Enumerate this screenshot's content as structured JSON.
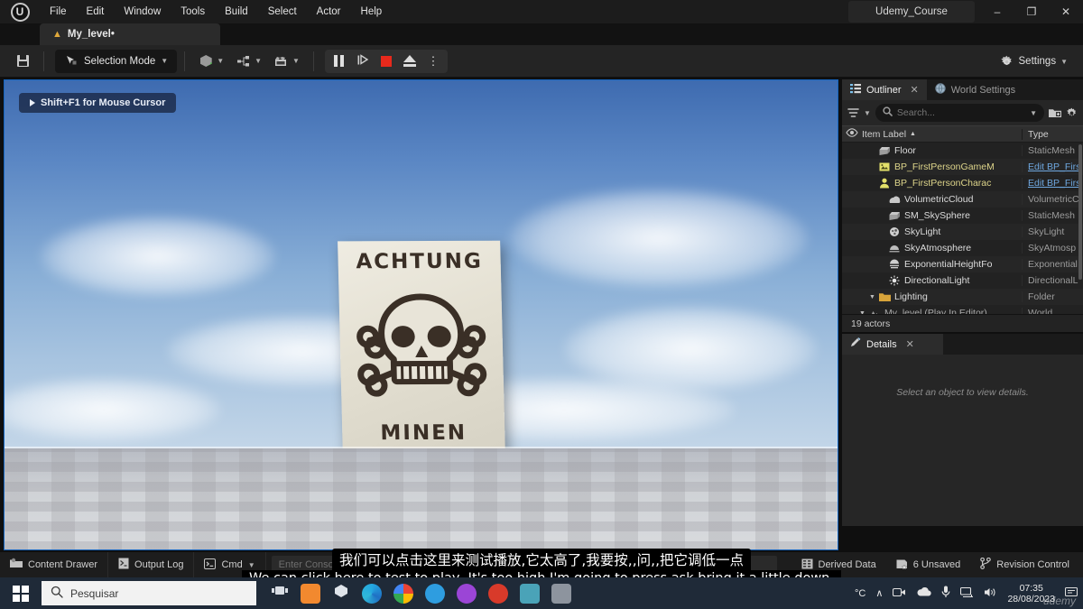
{
  "titlebar": {
    "logo_icon": "unreal-engine-logo",
    "menus": [
      "File",
      "Edit",
      "Window",
      "Tools",
      "Build",
      "Select",
      "Actor",
      "Help"
    ],
    "project_name": "Udemy_Course",
    "window_controls": {
      "minimize": "–",
      "maximize": "❐",
      "close": "✕"
    }
  },
  "level_tab": {
    "label": "My_level•",
    "icon": "level-icon"
  },
  "toolbar": {
    "save_icon": "save-icon",
    "mode_label": "Selection Mode",
    "add_icon": "add-actor-icon",
    "blueprints_icon": "blueprints-icon",
    "cinematics_icon": "cinematics-icon",
    "pause_icon": "pause-icon",
    "step_icon": "frame-step-icon",
    "stop_icon": "stop-icon",
    "eject_icon": "eject-icon",
    "more_icon": "more-options-icon",
    "settings_label": "Settings",
    "settings_icon": "gear-icon"
  },
  "viewport": {
    "hint": "Shift+F1 for Mouse Cursor",
    "sign_top_text": "ACHTUNG",
    "sign_bottom_text": "MINEN",
    "sign_symbol": "skull-and-crossbones"
  },
  "outliner": {
    "tab_label": "Outliner",
    "tab_icon": "outliner-icon",
    "world_settings_tab": "World Settings",
    "world_settings_icon": "globe-icon",
    "filter_icon": "filter-icon",
    "search_placeholder": "Search...",
    "search_value": "",
    "new_folder_icon": "new-folder-icon",
    "settings_icon": "gear-icon",
    "columns": {
      "visibility": "eye-icon",
      "label": "Item Label",
      "sort": "▲",
      "type": "Type"
    },
    "rows": [
      {
        "name": "My_level (Play In Editor)",
        "type": "World",
        "indent": 1,
        "icon": "level-icon",
        "expander": "▼",
        "kind": "world"
      },
      {
        "name": "Lighting",
        "type": "Folder",
        "indent": 2,
        "icon": "folder-icon",
        "expander": "▼",
        "kind": "folder"
      },
      {
        "name": "DirectionalLight",
        "type": "DirectionalL",
        "indent": 3,
        "icon": "directional-light-icon",
        "expander": "",
        "kind": "actor"
      },
      {
        "name": "ExponentialHeightFo",
        "type": "Exponential",
        "indent": 3,
        "icon": "height-fog-icon",
        "expander": "",
        "kind": "actor"
      },
      {
        "name": "SkyAtmosphere",
        "type": "SkyAtmosp",
        "indent": 3,
        "icon": "sky-atmosphere-icon",
        "expander": "",
        "kind": "actor"
      },
      {
        "name": "SkyLight",
        "type": "SkyLight",
        "indent": 3,
        "icon": "sky-light-icon",
        "expander": "",
        "kind": "actor"
      },
      {
        "name": "SM_SkySphere",
        "type": "StaticMesh",
        "indent": 3,
        "icon": "static-mesh-icon",
        "expander": "",
        "kind": "actor"
      },
      {
        "name": "VolumetricCloud",
        "type": "VolumetricC",
        "indent": 3,
        "icon": "volumetric-cloud-icon",
        "expander": "",
        "kind": "actor"
      },
      {
        "name": "BP_FirstPersonCharac",
        "type": "Edit BP_Firs",
        "indent": 2,
        "icon": "character-icon",
        "expander": "",
        "kind": "blueprint"
      },
      {
        "name": "BP_FirstPersonGameM",
        "type": "Edit BP_Firs",
        "indent": 2,
        "icon": "gamemode-icon",
        "expander": "",
        "kind": "blueprint"
      },
      {
        "name": "Floor",
        "type": "StaticMesh",
        "indent": 2,
        "icon": "static-mesh-icon",
        "expander": "",
        "kind": "actor"
      }
    ],
    "actor_count": "19 actors"
  },
  "details": {
    "tab_label": "Details",
    "tab_icon": "details-icon",
    "empty_message": "Select an object to view details."
  },
  "statusbar": {
    "content_drawer": "Content Drawer",
    "content_drawer_icon": "content-drawer-icon",
    "output_log": "Output Log",
    "output_log_icon": "output-log-icon",
    "cmd": "Cmd",
    "cmd_icon": "console-icon",
    "cmd_placeholder": "Enter Console Command",
    "derived_data": "Derived Data",
    "derived_data_icon": "derived-data-icon",
    "unsaved": "6 Unsaved",
    "unsaved_icon": "unsaved-icon",
    "revision_control": "Revision Control",
    "revision_control_icon": "source-control-icon"
  },
  "subtitles": {
    "chinese": "我们可以点击这里来测试播放,它太高了,我要按,,问,,把它调低一点",
    "english": "We can click here to test to play, It's too high,I'm going to press ask,bring it a little down,"
  },
  "taskbar": {
    "start_icon": "windows-start-icon",
    "search_placeholder": "Pesquisar",
    "search_icon": "search-icon",
    "apps": [
      "task-view-icon",
      "app-orange-icon",
      "app-blue-icon",
      "edge-icon",
      "chrome-icon",
      "app-cyan-icon",
      "app-purple-icon",
      "app-red-icon",
      "app-teal-icon",
      "app-gray-icon"
    ],
    "tray": {
      "temperature": "°C",
      "chevron": "∧",
      "icons": [
        "camera-icon",
        "onedrive-icon",
        "microphone-icon",
        "network-icon",
        "volume-icon"
      ],
      "time": "07:35",
      "date": "28/08/2023",
      "notification_icon": "notification-icon"
    },
    "watermark": "udemy"
  }
}
